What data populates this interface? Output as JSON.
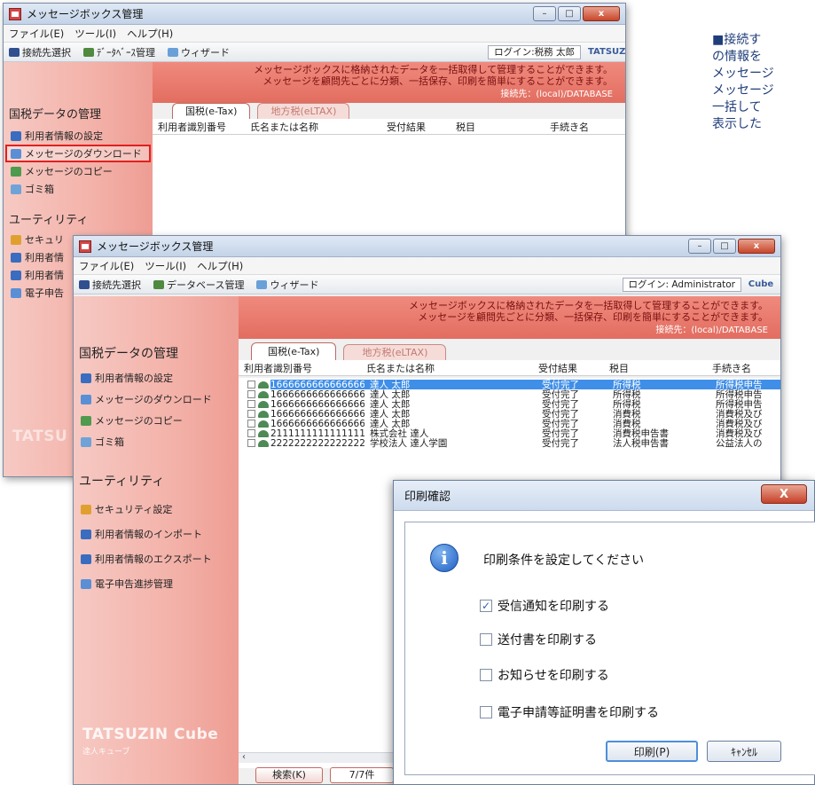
{
  "annotation": {
    "lines": [
      "■接続す",
      "の情報を",
      "メッセージ",
      "メッセージ",
      "一括して",
      "表示した"
    ]
  },
  "app": {
    "title": "メッセージボックス管理",
    "menu": [
      "ファイル(E)",
      "ツール(I)",
      "ヘルプ(H)"
    ],
    "toolbar": [
      "接続先選択",
      "データベース管理",
      "ウィザード"
    ],
    "back_toolbar_db": "ﾃﾞｰﾀﾍﾞｰｽ管理",
    "back_login": "ログイン:税務 太郎",
    "front_login": "ログイン: Administrator",
    "back_logo": "TATSUZI",
    "front_logo": "Cube"
  },
  "banner": {
    "line1": "メッセージボックスに格納されたデータを一括取得して管理することができます。",
    "line2": "メッセージを顧問先ごとに分類、一括保存、印刷を簡単にすることができます。",
    "connection": "接続先：(local)/DATABASE"
  },
  "tabs": [
    "国税(e-Tax)",
    "地方税(eLTAX)"
  ],
  "sidebar": {
    "section1": "国税データの管理",
    "items1": [
      "利用者情報の設定",
      "メッセージのダウンロード",
      "メッセージのコピー",
      "ゴミ箱"
    ],
    "section2": "ユーティリティ",
    "items2": [
      "セキュリティ設定",
      "利用者情報のインポート",
      "利用者情報のエクスポート",
      "電子申告進捗管理"
    ],
    "back_items2": [
      "セキュリ",
      "利用者情",
      "利用者情",
      "電子申告"
    ],
    "brand": "TATSUZIN Cube",
    "brand_sub": "達人キューブ",
    "brand_short": "TATSU"
  },
  "grid": {
    "columns": [
      "利用者識別番号",
      "氏名または名称",
      "受付結果",
      "税目",
      "手続き名"
    ],
    "rows": [
      {
        "id": "1666666666666666",
        "name": "達人 太郎",
        "result": "受付完了",
        "tax": "所得税",
        "proc": "所得税申告"
      },
      {
        "id": "1666666666666666",
        "name": "達人 太郎",
        "result": "受付完了",
        "tax": "所得税",
        "proc": "所得税申告"
      },
      {
        "id": "1666666666666666",
        "name": "達人 太郎",
        "result": "受付完了",
        "tax": "所得税",
        "proc": "所得税申告"
      },
      {
        "id": "1666666666666666",
        "name": "達人 太郎",
        "result": "受付完了",
        "tax": "消費税",
        "proc": "消費税及び"
      },
      {
        "id": "1666666666666666",
        "name": "達人 太郎",
        "result": "受付完了",
        "tax": "消費税",
        "proc": "消費税及び"
      },
      {
        "id": "2111111111111111",
        "name": "株式会社 達人",
        "result": "受付完了",
        "tax": "消費税申告書",
        "proc": "消費税及び"
      },
      {
        "id": "2222222222222222",
        "name": "学校法人 達人学園",
        "result": "受付完了",
        "tax": "法人税申告書",
        "proc": "公益法人の"
      }
    ]
  },
  "footer": {
    "search": "検索(K)",
    "count": "7/7件"
  },
  "dialog": {
    "title": "印刷確認",
    "close": "X",
    "message": "印刷条件を設定してください",
    "options": [
      {
        "label": "受信通知を印刷する",
        "checked": true
      },
      {
        "label": "送付書を印刷する",
        "checked": false
      },
      {
        "label": "お知らせを印刷する",
        "checked": false
      },
      {
        "label": "電子申請等証明書を印刷する",
        "checked": false
      }
    ],
    "print": "印刷(P)",
    "cancel": "ｷｬﾝｾﾙ"
  },
  "colors": {
    "highlight": "#e02020",
    "selection": "#3f8ee8",
    "banner": "#e26d60"
  }
}
